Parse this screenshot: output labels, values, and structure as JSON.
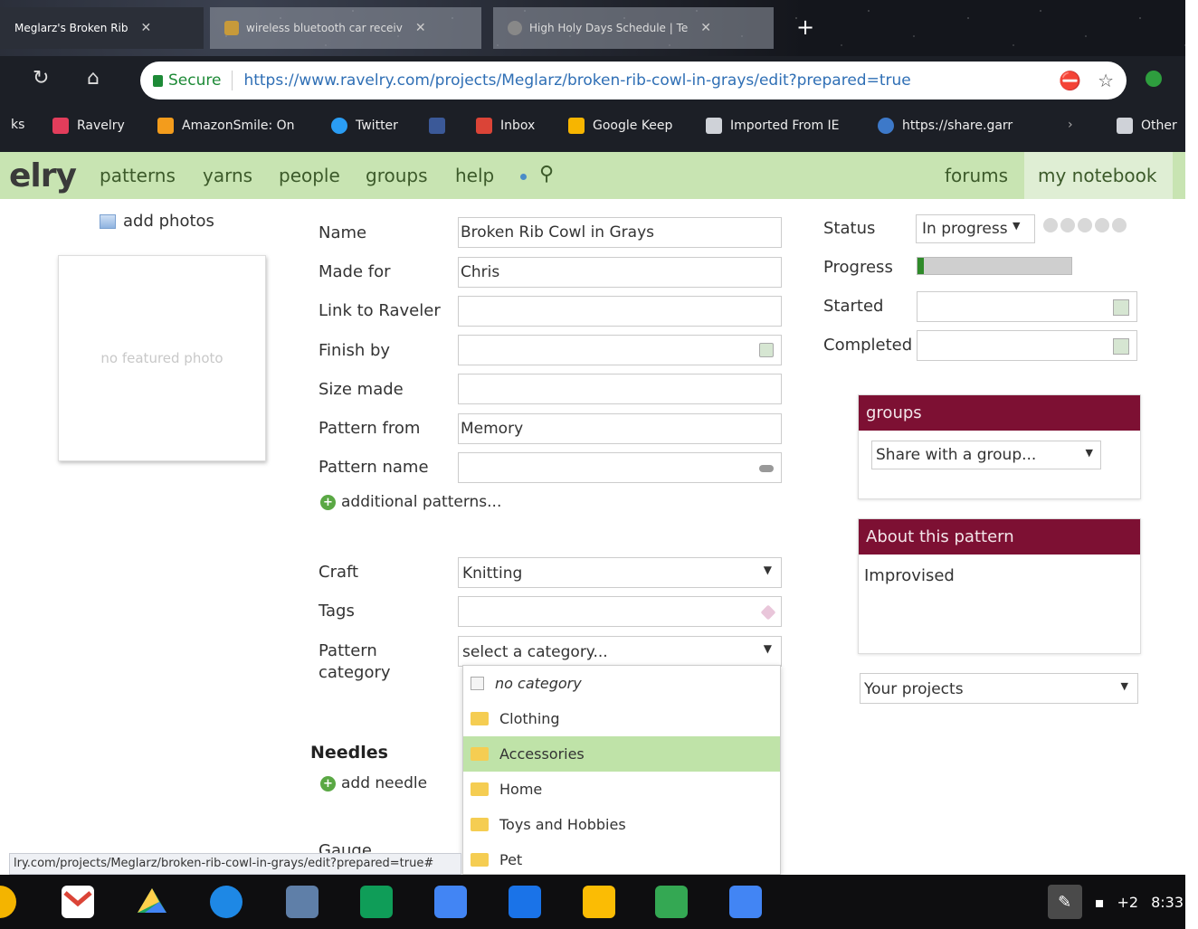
{
  "browser": {
    "tabs": [
      {
        "title": "Meglarz's Broken Rib",
        "active": true
      },
      {
        "title": "wireless bluetooth car receiv",
        "active": false
      },
      {
        "title": "High Holy Days Schedule | Te",
        "active": false
      }
    ],
    "new_tab": "+",
    "secure_label": "Secure",
    "url": "https://www.ravelry.com/projects/Meglarz/broken-rib-cowl-in-grays/edit?prepared=true",
    "bookmarks": [
      "ks",
      "Ravelry",
      "AmazonSmile: On",
      "Twitter",
      "",
      "Inbox",
      "Google Keep",
      "Imported From IE",
      "https://share.garr",
      "Other"
    ]
  },
  "nav": {
    "logo": "elry",
    "links": [
      "patterns",
      "yarns",
      "people",
      "groups",
      "help"
    ],
    "right_links": [
      "forums",
      "my notebook"
    ]
  },
  "photos": {
    "add_label": "add photos",
    "empty_label": "no featured photo"
  },
  "form": {
    "name_label": "Name",
    "name_value": "Broken Rib Cowl in Grays",
    "made_for_label": "Made for",
    "made_for_value": "Chris",
    "link_label": "Link to Raveler",
    "link_value": "",
    "finish_label": "Finish by",
    "finish_value": "",
    "size_label": "Size made",
    "size_value": "",
    "pattern_from_label": "Pattern from",
    "pattern_from_value": "Memory",
    "pattern_name_label": "Pattern name",
    "pattern_name_value": "",
    "additional_patterns": "additional patterns...",
    "craft_label": "Craft",
    "craft_value": "Knitting",
    "tags_label": "Tags",
    "tags_value": "",
    "category_label_1": "Pattern",
    "category_label_2": "category",
    "category_value": "select a category...",
    "needles_label": "Needles",
    "add_needle": "add needle",
    "gauge_label": "Gauge"
  },
  "category_dropdown": [
    {
      "label": "no category",
      "selected": false
    },
    {
      "label": "Clothing",
      "selected": false
    },
    {
      "label": "Accessories",
      "selected": true
    },
    {
      "label": "Home",
      "selected": false
    },
    {
      "label": "Toys and Hobbies",
      "selected": false
    },
    {
      "label": "Pet",
      "selected": false
    }
  ],
  "status": {
    "status_label": "Status",
    "status_value": "In progress",
    "progress_label": "Progress",
    "progress_fraction": 0.04,
    "started_label": "Started",
    "started_value": "",
    "completed_label": "Completed",
    "completed_value": ""
  },
  "groups_panel": {
    "title": "groups",
    "share_value": "Share with a group..."
  },
  "about_panel": {
    "title": "About this pattern",
    "text": "Improvised"
  },
  "your_projects": "Your projects",
  "status_url": "lry.com/projects/Meglarz/broken-rib-cowl-in-grays/edit?prepared=true#",
  "shelf": {
    "notifications": "+2",
    "time": "8:33"
  },
  "colors": {
    "nav_green": "#c8e4b2",
    "panel_maroon": "#7d1033",
    "selected_green": "#bfe3a8",
    "progress_green": "#2f8a2a"
  }
}
